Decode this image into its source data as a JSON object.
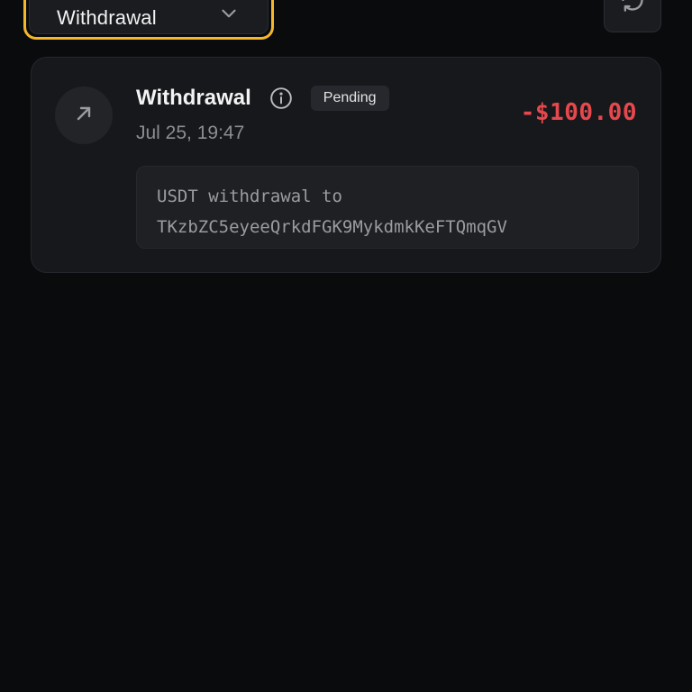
{
  "filter": {
    "selected": "Withdrawal",
    "icon": "chevron-down-icon",
    "focus_color": "#f5b72a"
  },
  "refresh": {
    "icon": "refresh-icon"
  },
  "transaction": {
    "direction_icon": "arrow-up-right-icon",
    "title": "Withdrawal",
    "info_icon": "info-icon",
    "status": "Pending",
    "date": "Jul 25, 19:47",
    "amount": "-$100.00",
    "amount_color": "#e5484d",
    "note_line1": "USDT withdrawal to",
    "note_line2": "TKzbZC5eyeeQrkdFGK9MykdmkKeFTQmqGV"
  }
}
